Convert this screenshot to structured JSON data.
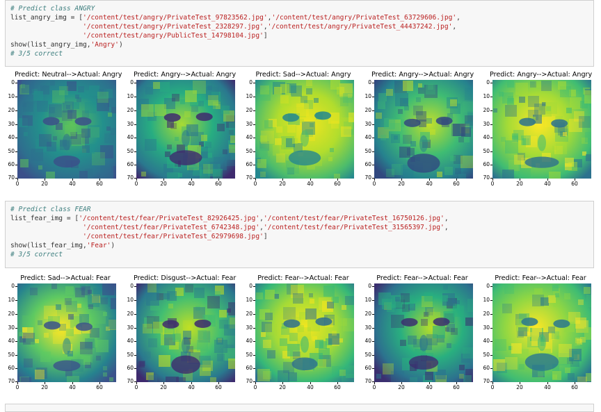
{
  "cells": [
    {
      "id": "angry",
      "lines": [
        [
          {
            "t": "# Predict class ANGRY",
            "c": "com"
          }
        ],
        [
          {
            "t": "list_angry_img = [",
            "c": ""
          },
          {
            "t": "'/content/test/angry/PrivateTest_97823562.jpg'",
            "c": "str"
          },
          {
            "t": ",",
            "c": ""
          },
          {
            "t": "'/content/test/angry/PrivateTest_63729606.jpg'",
            "c": "str"
          },
          {
            "t": ",",
            "c": ""
          }
        ],
        [
          {
            "t": "                  ",
            "c": ""
          },
          {
            "t": "'/content/test/angry/PrivateTest_2328297.jpg'",
            "c": "str"
          },
          {
            "t": ",",
            "c": ""
          },
          {
            "t": "'/content/test/angry/PrivateTest_44437242.jpg'",
            "c": "str"
          },
          {
            "t": ",",
            "c": ""
          }
        ],
        [
          {
            "t": "                  ",
            "c": ""
          },
          {
            "t": "'/content/test/angry/PublicTest_14798104.jpg'",
            "c": "str"
          },
          {
            "t": "]",
            "c": ""
          }
        ],
        [
          {
            "t": "show(list_angry_img,",
            "c": ""
          },
          {
            "t": "'Angry'",
            "c": "str"
          },
          {
            "t": ")",
            "c": ""
          }
        ],
        [
          {
            "t": "# 3/5 correct",
            "c": "com"
          }
        ]
      ],
      "figures": [
        {
          "title": "Predict: Neutral-->Actual: Angry",
          "palette": [
            "#3b4f8a",
            "#2e6f8e",
            "#23908c",
            "#5fc45a"
          ]
        },
        {
          "title": "Predict: Angry-->Actual: Angry",
          "palette": [
            "#3e2a6e",
            "#2a788e",
            "#27ad81",
            "#a8db34"
          ]
        },
        {
          "title": "Predict: Sad-->Actual: Angry",
          "palette": [
            "#24878e",
            "#4cbc6c",
            "#b2dd2d",
            "#f0e51f"
          ]
        },
        {
          "title": "Predict: Angry-->Actual: Angry",
          "palette": [
            "#31487f",
            "#26828e",
            "#3fbc73",
            "#c3e02a"
          ]
        },
        {
          "title": "Predict: Angry-->Actual: Angry",
          "palette": [
            "#2c718e",
            "#3fbc73",
            "#a5db36",
            "#fde725"
          ]
        }
      ]
    },
    {
      "id": "fear",
      "lines": [
        [
          {
            "t": "# Predict class FEAR",
            "c": "com"
          }
        ],
        [
          {
            "t": "list_fear_img = [",
            "c": ""
          },
          {
            "t": "'/content/test/fear/PrivateTest_82926425.jpg'",
            "c": "str"
          },
          {
            "t": ",",
            "c": ""
          },
          {
            "t": "'/content/test/fear/PrivateTest_16750126.jpg'",
            "c": "str"
          },
          {
            "t": ",",
            "c": ""
          }
        ],
        [
          {
            "t": "                  ",
            "c": ""
          },
          {
            "t": "'/content/test/fear/PrivateTest_6742348.jpg'",
            "c": "str"
          },
          {
            "t": ",",
            "c": ""
          },
          {
            "t": "'/content/test/fear/PrivateTest_31565397.jpg'",
            "c": "str"
          },
          {
            "t": ",",
            "c": ""
          }
        ],
        [
          {
            "t": "                  ",
            "c": ""
          },
          {
            "t": "'/content/test/fear/PrivateTest_62979698.jpg'",
            "c": "str"
          },
          {
            "t": "]",
            "c": ""
          }
        ],
        [
          {
            "t": "show(list_fear_img,",
            "c": ""
          },
          {
            "t": "'Fear'",
            "c": "str"
          },
          {
            "t": ")",
            "c": ""
          }
        ],
        [
          {
            "t": "# 3/5 correct",
            "c": "com"
          }
        ]
      ],
      "figures": [
        {
          "title": "Predict: Sad-->Actual: Fear",
          "palette": [
            "#3b528b",
            "#26828e",
            "#5ec962",
            "#fde725"
          ]
        },
        {
          "title": "Predict: Disgust-->Actual: Fear",
          "palette": [
            "#3e2a6e",
            "#2a788e",
            "#42be71",
            "#c0df25"
          ]
        },
        {
          "title": "Predict: Fear-->Actual: Fear",
          "palette": [
            "#2e6f8e",
            "#35b779",
            "#a5db36",
            "#f4e61e"
          ]
        },
        {
          "title": "Predict: Fear-->Actual: Fear",
          "palette": [
            "#3b2f70",
            "#2c728e",
            "#29af7f",
            "#b8de29"
          ]
        },
        {
          "title": "Predict: Fear-->Actual: Fear",
          "palette": [
            "#2a788e",
            "#3fbc73",
            "#90d743",
            "#fde725"
          ]
        }
      ]
    }
  ],
  "axis": {
    "y_ticks": [
      "0",
      "10",
      "20",
      "30",
      "40",
      "50",
      "60",
      "70"
    ],
    "x_ticks": [
      "0",
      "20",
      "40",
      "60"
    ]
  }
}
